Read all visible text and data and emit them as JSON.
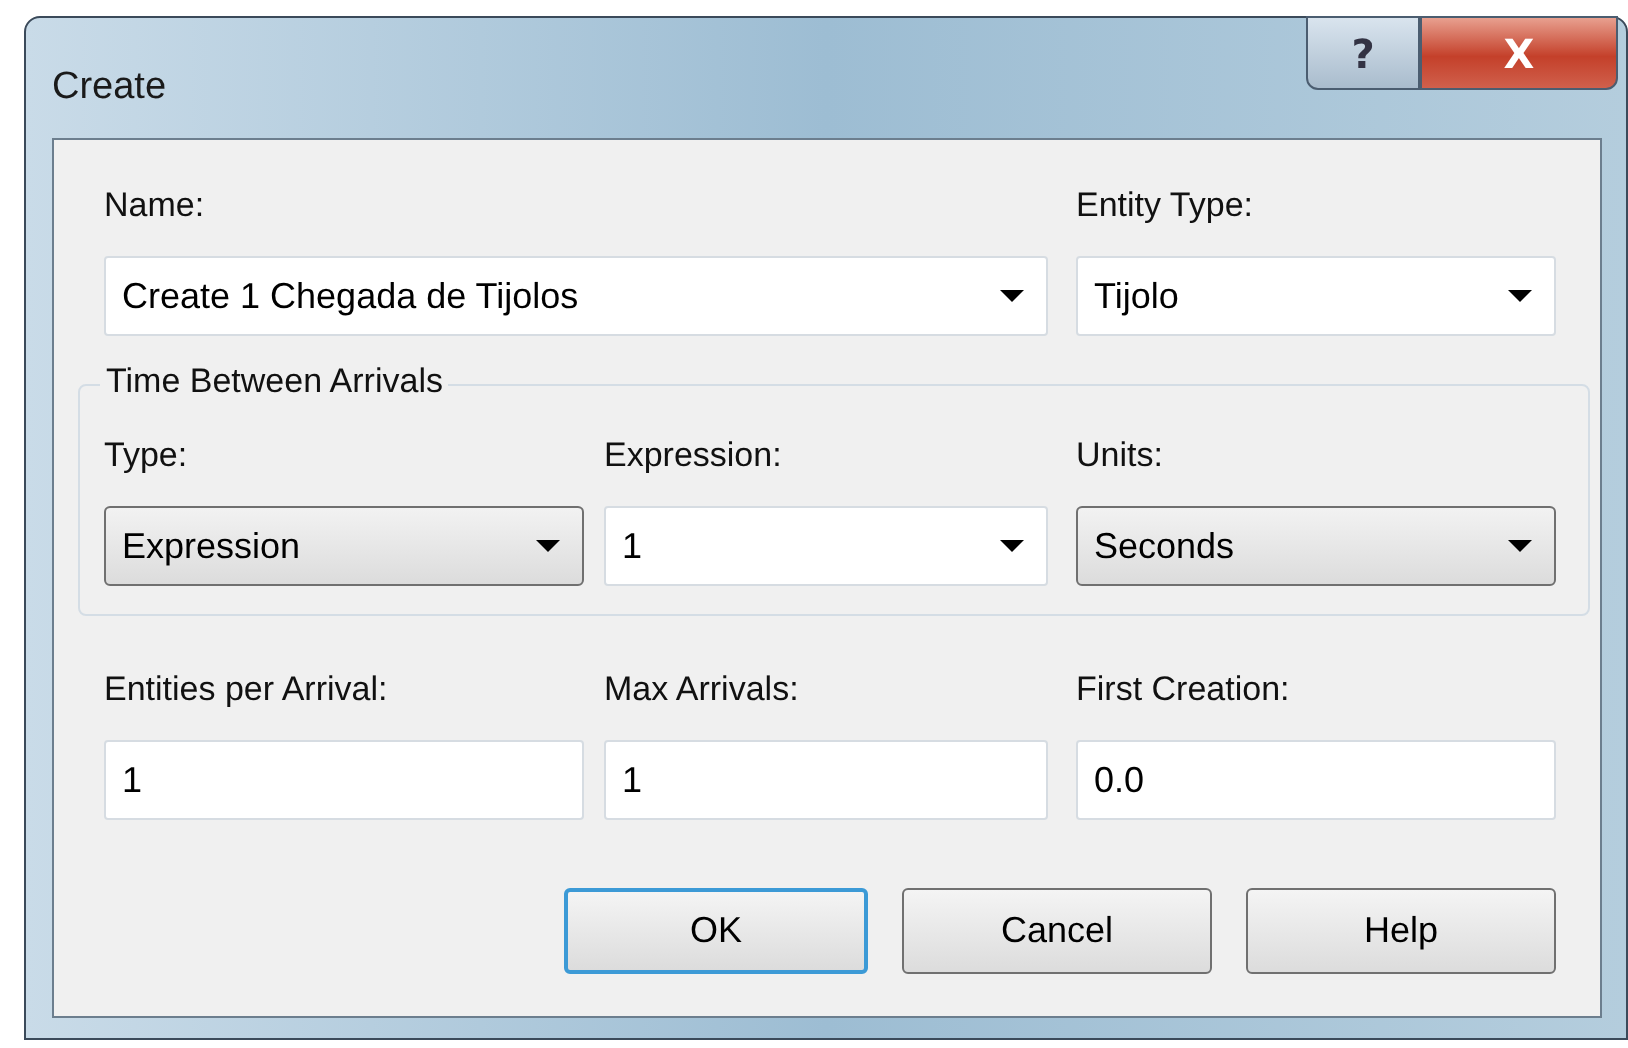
{
  "window": {
    "title": "Create",
    "help_button": "?",
    "close_button": "X"
  },
  "top_fields": [
    {
      "label": "Name:",
      "value": "Create 1 Chegada de Tijolos",
      "kind": "combo"
    },
    {
      "label": "Entity Type:",
      "value": "Tijolo",
      "kind": "combo"
    }
  ],
  "group": {
    "title": "Time Between Arrivals",
    "fields": [
      {
        "label": "Type:",
        "value": "Expression",
        "kind": "list"
      },
      {
        "label": "Expression:",
        "value": "1",
        "kind": "combo"
      },
      {
        "label": "Units:",
        "value": "Seconds",
        "kind": "list"
      }
    ]
  },
  "bottom_fields": [
    {
      "label": "Entities per Arrival:",
      "value": "1",
      "kind": "text"
    },
    {
      "label": "Max Arrivals:",
      "value": "1",
      "kind": "text"
    },
    {
      "label": "First Creation:",
      "value": "0.0",
      "kind": "text"
    }
  ],
  "buttons": [
    {
      "label": "OK",
      "default": true
    },
    {
      "label": "Cancel",
      "default": false
    },
    {
      "label": "Help",
      "default": false
    }
  ]
}
